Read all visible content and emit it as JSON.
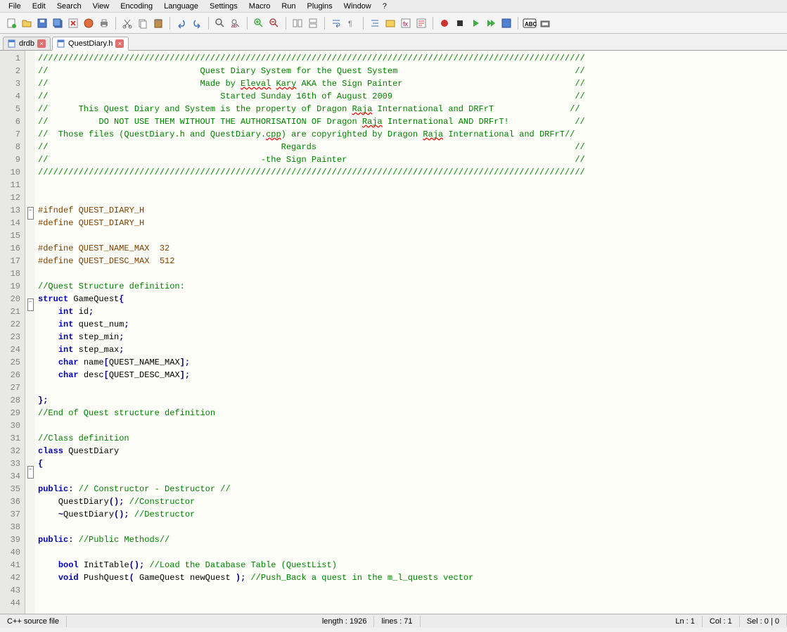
{
  "menu": [
    "File",
    "Edit",
    "Search",
    "View",
    "Encoding",
    "Language",
    "Settings",
    "Macro",
    "Run",
    "Plugins",
    "Window",
    "?"
  ],
  "tabs": [
    {
      "label": "drdb",
      "active": false
    },
    {
      "label": "QuestDiary.h",
      "active": true
    }
  ],
  "status": {
    "left": "C++ source file",
    "length": "length : 1926",
    "lines": "lines : 71",
    "ln": "Ln : 1",
    "col": "Col : 1",
    "sel": "Sel : 0 | 0"
  },
  "code_lines": [
    {
      "n": 1,
      "t": "comment",
      "s": "////////////////////////////////////////////////////////////////////////////////////////////////////////////"
    },
    {
      "n": 2,
      "t": "comment",
      "s": "//                              Quest Diary System for the Quest System                                   //"
    },
    {
      "n": 3,
      "t": "comment",
      "s": "//                              Made by Eleval Kary AKA the Sign Painter                                  //",
      "wavy": [
        "Eleval",
        "Kary"
      ]
    },
    {
      "n": 4,
      "t": "comment",
      "s": "//                                  Started Sunday 16th of August 2009                                    //"
    },
    {
      "n": 5,
      "t": "comment",
      "s": "//      This Quest Diary and System is the property of Dragon Raja International and DRFrT               //",
      "wavy": [
        "Raja"
      ]
    },
    {
      "n": 6,
      "t": "comment",
      "s": "//          DO NOT USE THEM WITHOUT THE AUTHORISATION OF Dragon Raja International AND DRFrT!             //",
      "wavy": [
        "Raja"
      ]
    },
    {
      "n": 7,
      "t": "comment",
      "s": "//  Those files (QuestDiary.h and QuestDiary.cpp) are copyrighted by Dragon Raja International and DRFrT//",
      "wavy": [
        "cpp",
        "Raja"
      ]
    },
    {
      "n": 8,
      "t": "comment",
      "s": "//                                              Regards                                                   //"
    },
    {
      "n": 9,
      "t": "comment",
      "s": "//                                          -the Sign Painter                                             //"
    },
    {
      "n": 10,
      "t": "comment",
      "s": "////////////////////////////////////////////////////////////////////////////////////////////////////////////"
    },
    {
      "n": 11,
      "t": "blank",
      "s": ""
    },
    {
      "n": 12,
      "t": "blank",
      "s": ""
    },
    {
      "n": 13,
      "t": "preproc",
      "s": "#ifndef QUEST_DIARY_H",
      "fold": "minus"
    },
    {
      "n": 14,
      "t": "preproc",
      "s": "#define QUEST_DIARY_H"
    },
    {
      "n": 15,
      "t": "blank",
      "s": ""
    },
    {
      "n": 16,
      "t": "preproc",
      "s": "#define QUEST_NAME_MAX  32"
    },
    {
      "n": 17,
      "t": "preproc",
      "s": "#define QUEST_DESC_MAX  512"
    },
    {
      "n": 18,
      "t": "blank",
      "s": ""
    },
    {
      "n": 19,
      "t": "comment",
      "s": "//Quest Structure definition:"
    },
    {
      "n": 20,
      "t": "struct",
      "s": "struct GameQuest{",
      "fold": "minus"
    },
    {
      "n": 21,
      "t": "member",
      "s": "    int id;"
    },
    {
      "n": 22,
      "t": "member",
      "s": "    int quest_num;"
    },
    {
      "n": 23,
      "t": "member",
      "s": "    int step_min;"
    },
    {
      "n": 24,
      "t": "member",
      "s": "    int step_max;"
    },
    {
      "n": 25,
      "t": "member_char",
      "s": "    char name[QUEST_NAME_MAX];"
    },
    {
      "n": 26,
      "t": "member_char",
      "s": "    char desc[QUEST_DESC_MAX];"
    },
    {
      "n": 27,
      "t": "blank",
      "s": ""
    },
    {
      "n": 28,
      "t": "close",
      "s": "};"
    },
    {
      "n": 29,
      "t": "comment",
      "s": "//End of Quest structure definition"
    },
    {
      "n": 30,
      "t": "blank",
      "s": ""
    },
    {
      "n": 31,
      "t": "comment",
      "s": "//Class definition"
    },
    {
      "n": 32,
      "t": "class",
      "s": "class QuestDiary"
    },
    {
      "n": 33,
      "t": "open",
      "s": "{",
      "fold": "minus"
    },
    {
      "n": 34,
      "t": "blank",
      "s": ""
    },
    {
      "n": 35,
      "t": "public_c",
      "s": "public: // Constructor - Destructor //"
    },
    {
      "n": 36,
      "t": "ctor",
      "s": "    QuestDiary(); //Constructor"
    },
    {
      "n": 37,
      "t": "dtor",
      "s": "    ~QuestDiary(); //Destructor"
    },
    {
      "n": 38,
      "t": "blank",
      "s": ""
    },
    {
      "n": 39,
      "t": "public_m",
      "s": "public: //Public Methods//"
    },
    {
      "n": 40,
      "t": "blank",
      "s": ""
    },
    {
      "n": 41,
      "t": "method_bool",
      "s": "    bool InitTable(); //Load the Database Table (QuestList)"
    },
    {
      "n": 42,
      "t": "method_void",
      "s": "    void PushQuest( GameQuest newQuest ); //Push_Back a quest in the m_l_quests vector"
    },
    {
      "n": 43,
      "t": "blank",
      "s": ""
    },
    {
      "n": 44,
      "t": "blank",
      "s": ""
    }
  ]
}
